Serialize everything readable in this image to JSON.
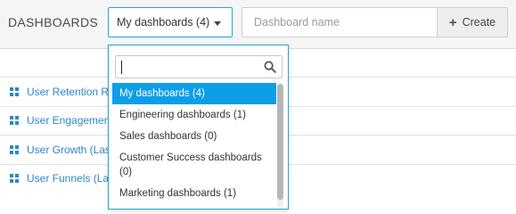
{
  "header": {
    "title": "DASHBOARDS",
    "dropdown_label": "My dashboards (4)",
    "name_placeholder": "Dashboard name",
    "create_label": "Create"
  },
  "list": {
    "items": [
      "User Retention R",
      "User Engagemen",
      "User Growth (Las",
      "User Funnels (La"
    ]
  },
  "dropdown": {
    "search_value": "",
    "options": [
      "My dashboards (4)",
      "Engineering dashboards (1)",
      "Sales dashboards (0)",
      "Customer Success dashboards (0)",
      "Marketing dashboards (1)"
    ],
    "selected_option": "My dashboards (4)"
  },
  "colors": {
    "accent": "#29a3d8",
    "selected_bg": "#0e9ee8",
    "link": "#2d88c8"
  },
  "icons": {
    "create": "plus-icon",
    "dropdown": "caret-down-icon",
    "search": "search-icon",
    "list_item": "dashboard-grid-icon"
  }
}
